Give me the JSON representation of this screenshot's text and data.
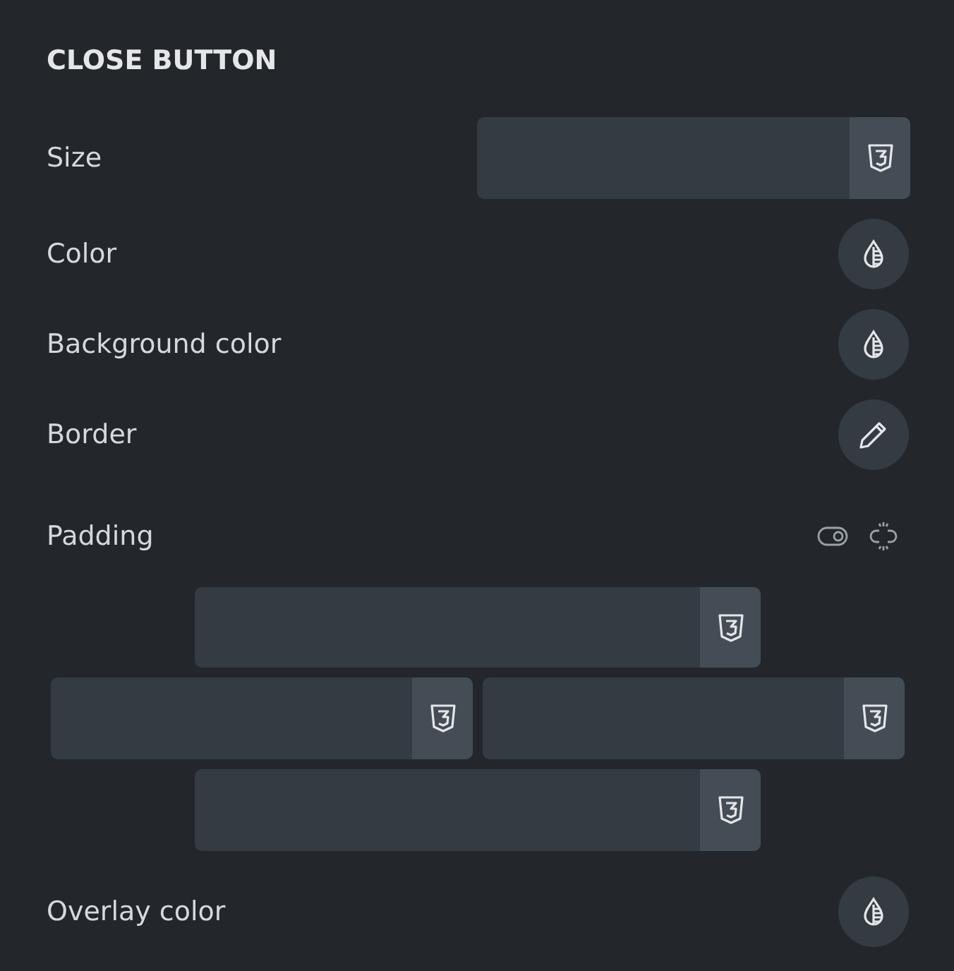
{
  "section_title": "CLOSE BUTTON",
  "controls": [
    {
      "kind": "size",
      "label": "Size"
    },
    {
      "kind": "color",
      "label": "Color"
    },
    {
      "kind": "color",
      "label": "Background color"
    },
    {
      "kind": "border",
      "label": "Border"
    },
    {
      "kind": "padding",
      "label": "Padding"
    },
    {
      "kind": "color",
      "label": "Overlay color"
    }
  ]
}
